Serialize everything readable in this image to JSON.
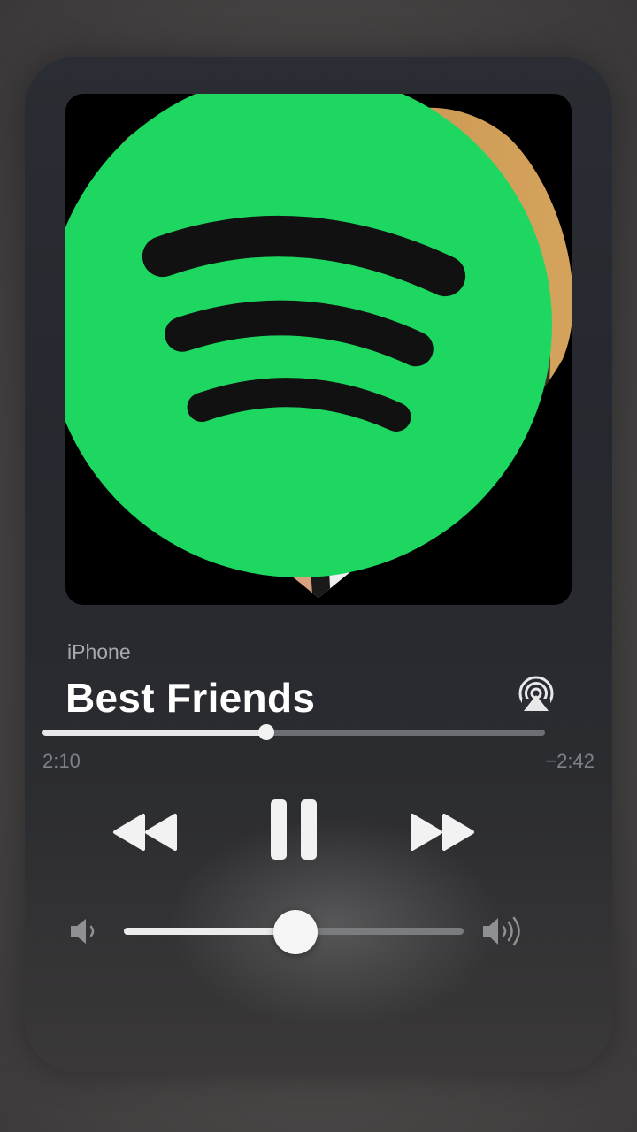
{
  "player": {
    "source": "iPhone",
    "title": "Best Friends",
    "elapsed": "2:10",
    "remaining": "−2:42",
    "progress_fraction": 0.445,
    "volume_fraction": 0.505
  },
  "icons": {
    "source_app": "spotify-icon",
    "output": "airplay-icon",
    "rewind": "rewind-icon",
    "pause": "pause-icon",
    "forward": "fast-forward-icon",
    "volume_low": "speaker-low-icon",
    "volume_high": "speaker-high-icon"
  },
  "colors": {
    "spotify_green": "#1ed760",
    "text_primary": "#ffffff",
    "text_secondary": "#a7a9ae"
  }
}
